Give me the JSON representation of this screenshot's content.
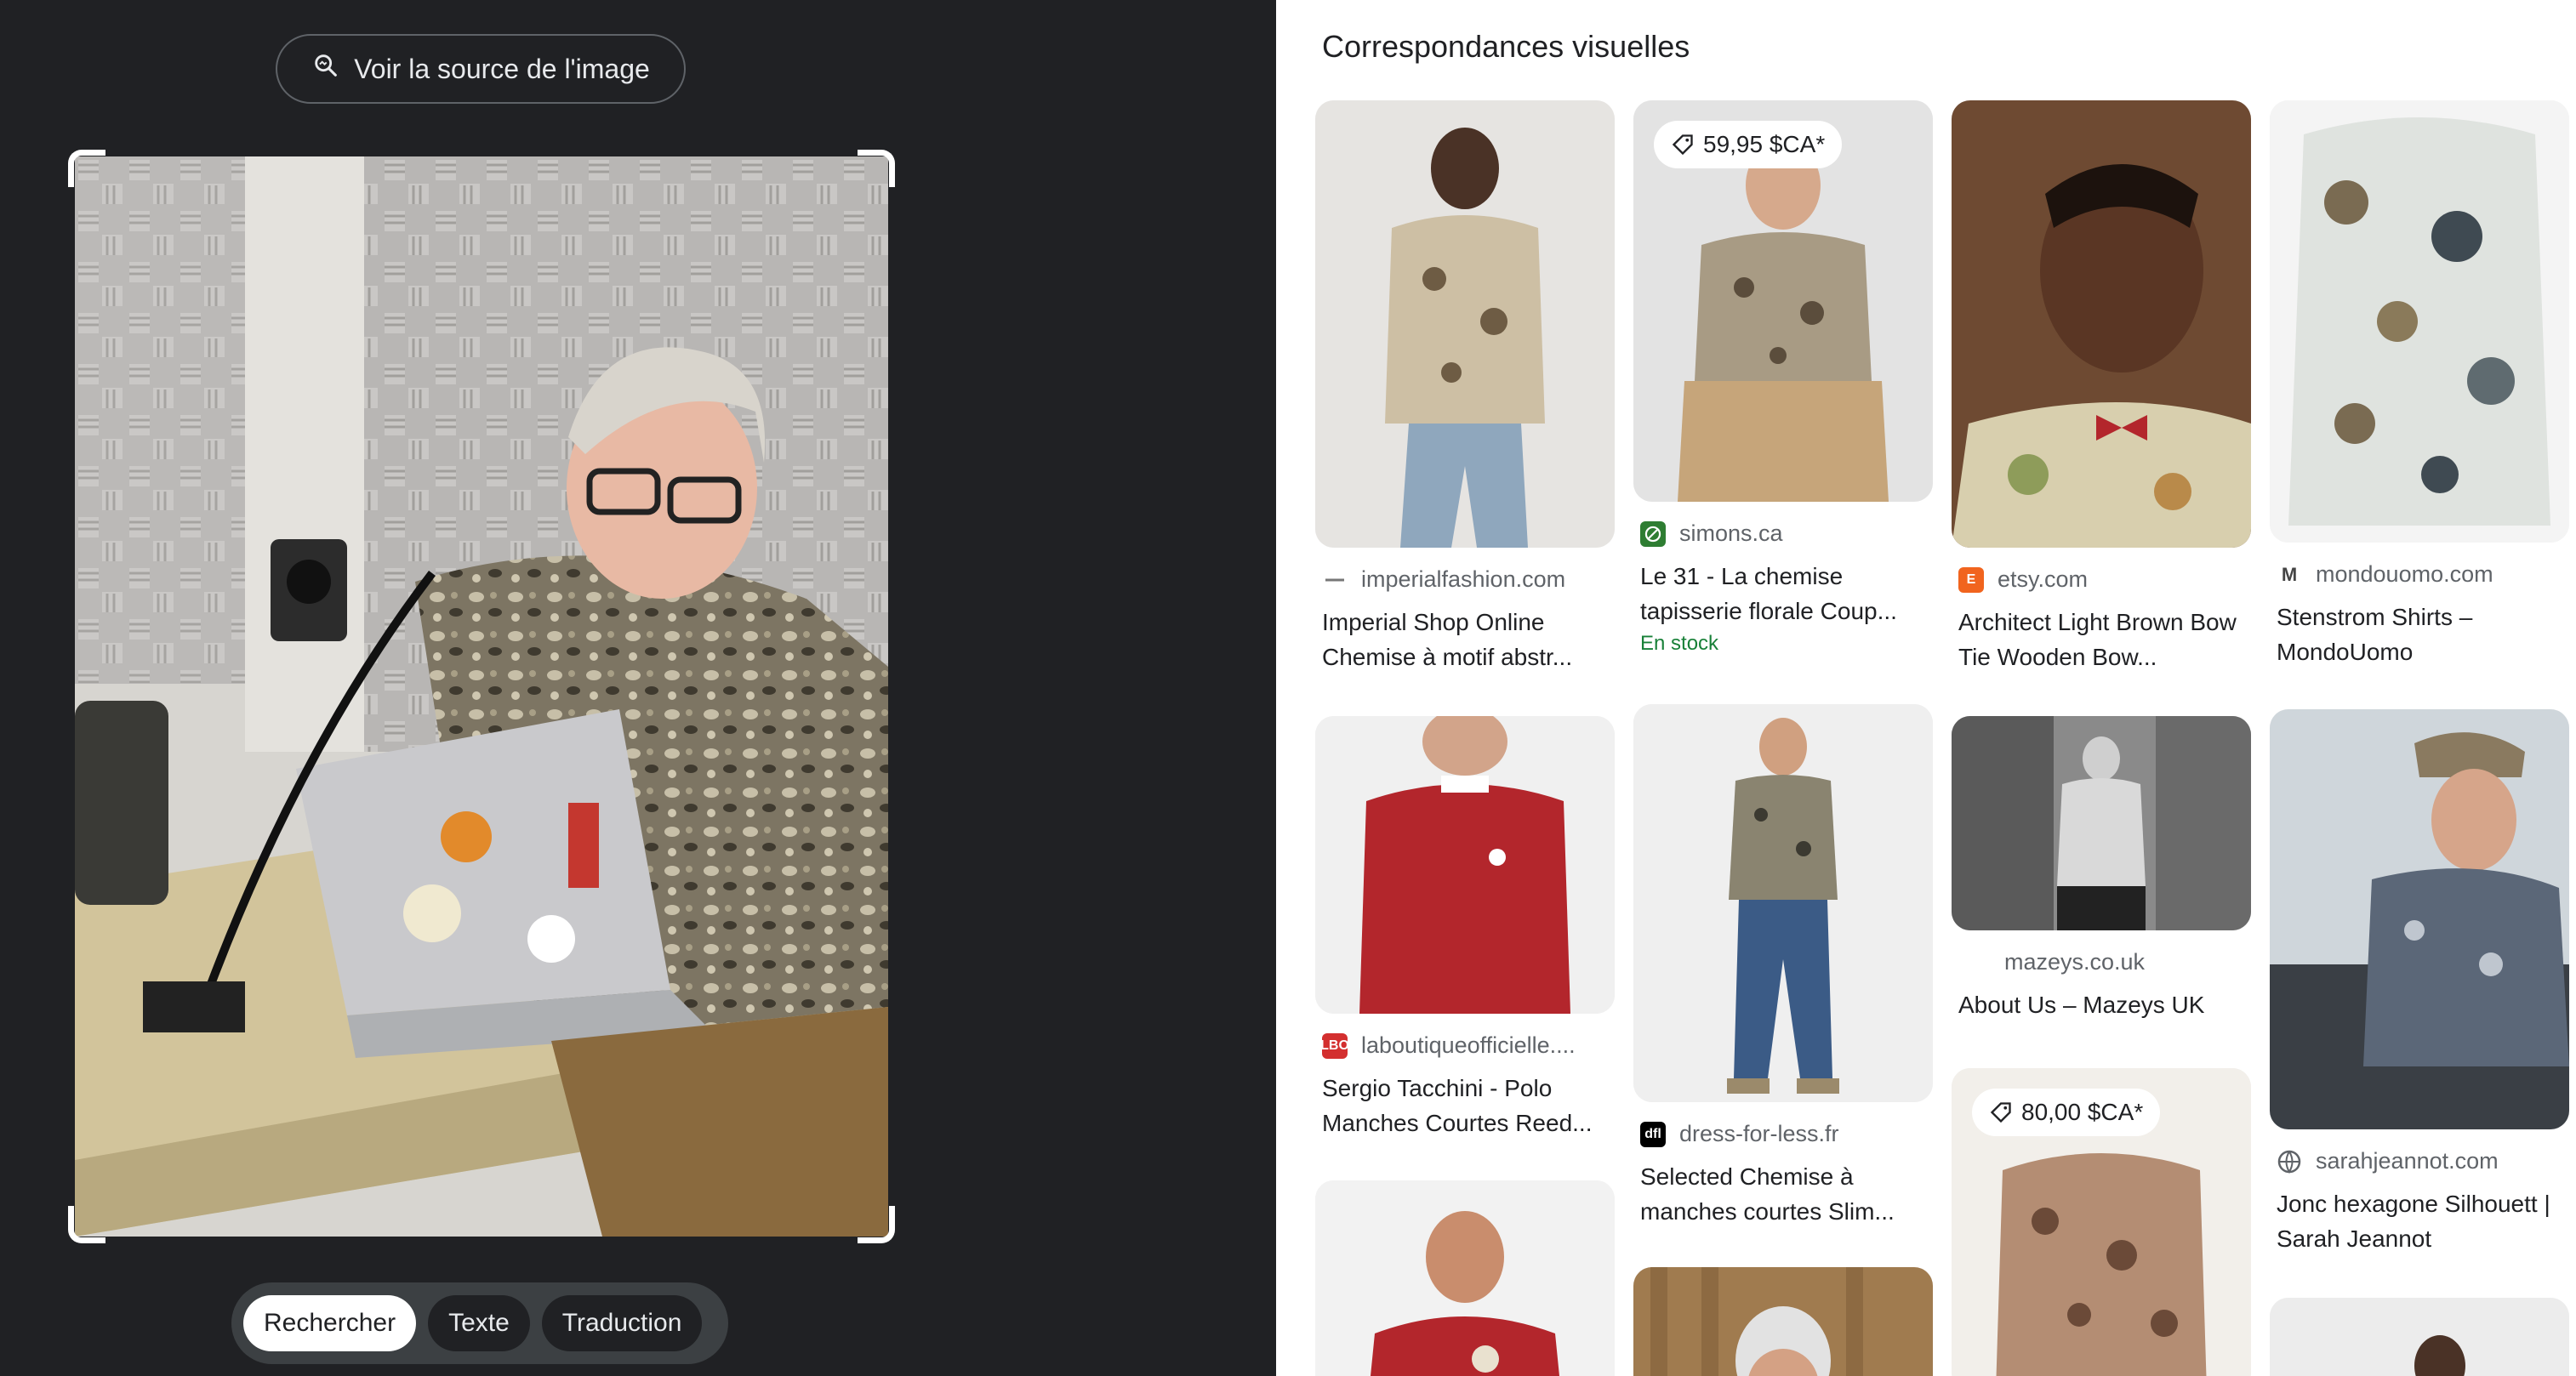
{
  "left": {
    "view_source_label": "Voir la source de l'image",
    "modes": [
      {
        "label": "Rechercher",
        "active": true
      },
      {
        "label": "Texte",
        "active": false
      },
      {
        "label": "Traduction",
        "active": false
      }
    ]
  },
  "results": {
    "title": "Correspondances visuelles",
    "items": [
      {
        "source": "imperialfashion.com",
        "title": "Imperial Shop Online Chemise à motif abstr..."
      },
      {
        "source": "simons.ca",
        "title": "Le 31 - La chemise tapisserie florale Coup...",
        "price": "59,95 $CA*",
        "stock": "En stock"
      },
      {
        "source": "etsy.com",
        "title": "Architect Light Brown Bow Tie Wooden Bow..."
      },
      {
        "source": "mondouomo.com",
        "title": "Stenstrom Shirts – MondoUomo"
      },
      {
        "source": "laboutiqueofficielle....",
        "title": "Sergio Tacchini - Polo Manches Courtes Reed..."
      },
      {
        "source": "dress-for-less.fr",
        "title": "Selected Chemise à manches courtes Slim..."
      },
      {
        "source": "mazeys.co.uk",
        "title": "About Us – Mazeys UK"
      },
      {
        "source": "sarahjeannot.com",
        "title": "Jonc hexagone Silhouett | Sarah Jeannot"
      },
      {
        "price": "80,00 $CA*"
      }
    ]
  },
  "favicons": {
    "simons": "#2e7d32",
    "etsy": "#f1641e",
    "laboutique": "#d32f2f",
    "dfl": "#000000"
  }
}
